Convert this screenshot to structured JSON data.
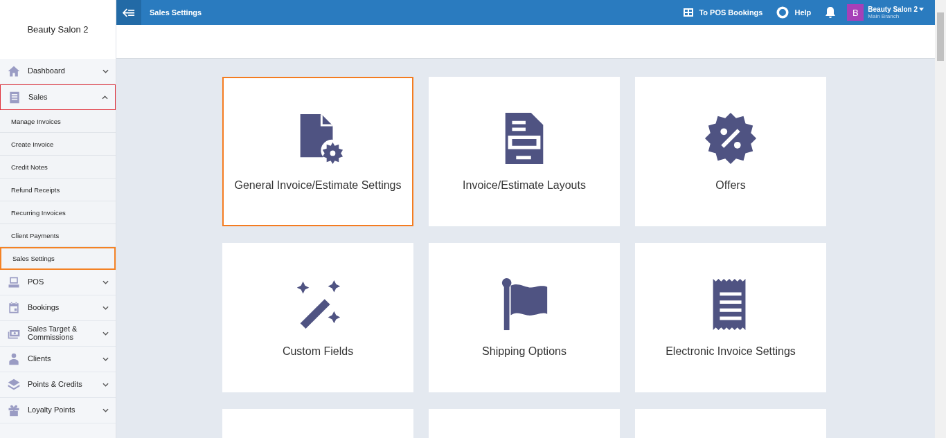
{
  "brand": "Beauty Salon 2",
  "sidebar": {
    "items": [
      {
        "label": "Dashboard",
        "kind": "home",
        "expanded": false,
        "selected": false
      },
      {
        "label": "Sales",
        "kind": "receipt",
        "expanded": true,
        "selected": true,
        "children": [
          {
            "label": "Manage Invoices",
            "selected": false
          },
          {
            "label": "Create Invoice",
            "selected": false
          },
          {
            "label": "Credit Notes",
            "selected": false
          },
          {
            "label": "Refund Receipts",
            "selected": false
          },
          {
            "label": "Recurring Invoices",
            "selected": false
          },
          {
            "label": "Client Payments",
            "selected": false
          },
          {
            "label": "Sales Settings",
            "selected": true
          }
        ]
      },
      {
        "label": "POS",
        "kind": "pos",
        "expanded": false,
        "selected": false
      },
      {
        "label": "Bookings",
        "kind": "calendar",
        "expanded": false,
        "selected": false
      },
      {
        "label": "Sales Target & Commissions",
        "kind": "money",
        "expanded": false,
        "selected": false
      },
      {
        "label": "Clients",
        "kind": "person",
        "expanded": false,
        "selected": false
      },
      {
        "label": "Points & Credits",
        "kind": "layers",
        "expanded": false,
        "selected": false
      },
      {
        "label": "Loyalty Points",
        "kind": "gift",
        "expanded": false,
        "selected": false
      }
    ]
  },
  "topbar": {
    "title": "Sales Settings",
    "pos_link": "To POS Bookings",
    "help": "Help",
    "account": {
      "avatar": "B",
      "name": "Beauty Salon 2",
      "branch": "Main Branch"
    }
  },
  "cards": [
    {
      "kind": "settings",
      "label": "General Invoice/Estimate Settings",
      "selected": true
    },
    {
      "kind": "layout",
      "label": "Invoice/Estimate Layouts",
      "selected": false
    },
    {
      "kind": "offer",
      "label": "Offers",
      "selected": false
    },
    {
      "kind": "wand",
      "label": "Custom Fields",
      "selected": false
    },
    {
      "kind": "flag",
      "label": "Shipping Options",
      "selected": false
    },
    {
      "kind": "receipt",
      "label": "Electronic Invoice Settings",
      "selected": false
    },
    {
      "kind": "blank",
      "selected": false
    },
    {
      "kind": "blank",
      "selected": false
    },
    {
      "kind": "blank",
      "selected": false
    }
  ]
}
